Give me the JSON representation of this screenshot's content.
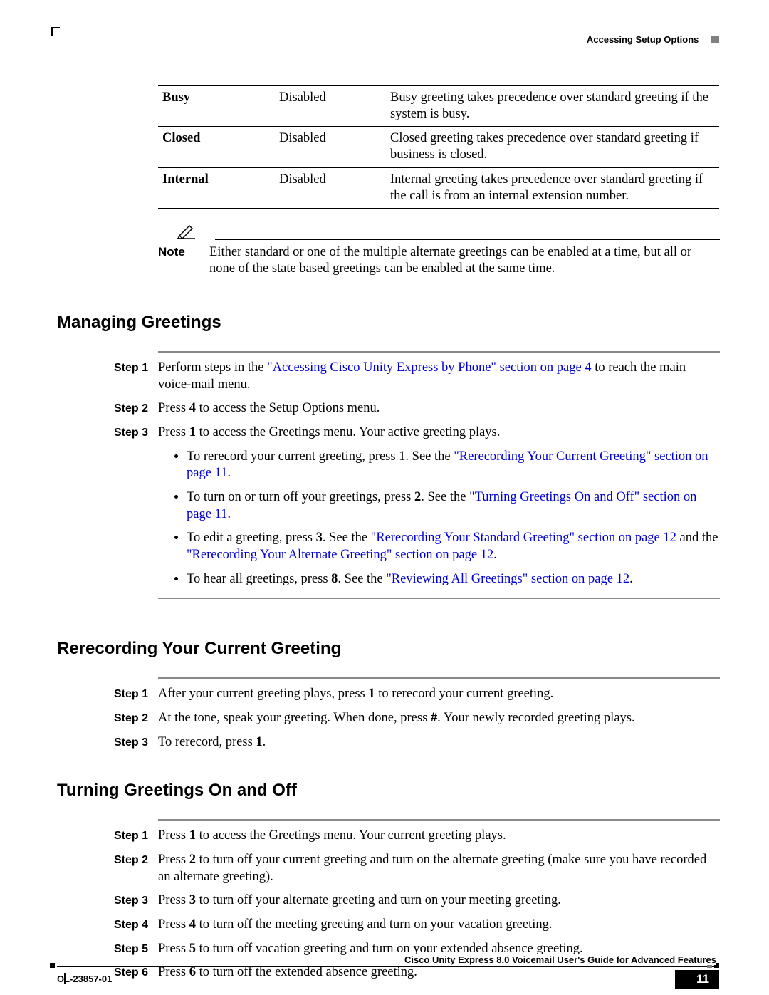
{
  "header": {
    "section": "Accessing Setup Options"
  },
  "table": {
    "rows": [
      {
        "name": "Busy",
        "state": "Disabled",
        "desc": "Busy greeting takes precedence over standard greeting if the system is busy."
      },
      {
        "name": "Closed",
        "state": "Disabled",
        "desc": "Closed greeting takes precedence over standard greeting if business is closed."
      },
      {
        "name": "Internal",
        "state": "Disabled",
        "desc": "Internal greeting takes precedence over standard greeting if the call is from an internal extension number."
      }
    ]
  },
  "note": {
    "label": "Note",
    "text": "Either standard or one of the multiple alternate greetings can be enabled at a time, but all or none of the state based greetings can be enabled at the same time."
  },
  "headings": {
    "managing": "Managing Greetings",
    "rerecord": "Rerecording Your Current Greeting",
    "turning": "Turning Greetings On and Off"
  },
  "managing": {
    "step1_a": "Perform steps in the ",
    "step1_link": "\"Accessing Cisco Unity Express by Phone\" section on page 4",
    "step1_b": " to reach the main voice-mail menu.",
    "step2_a": "Press ",
    "step2_k": "4",
    "step2_b": " to access the Setup Options menu.",
    "step3_a": "Press ",
    "step3_k": "1",
    "step3_b": " to access the Greetings menu. Your active greeting plays.",
    "b1_a": "To rerecord your current greeting, press 1. See the ",
    "b1_link": "\"Rerecording Your Current Greeting\" section on page 11",
    "b1_b": ".",
    "b2_a": "To turn on or turn off your greetings, press ",
    "b2_k": "2",
    "b2_b": ". See the ",
    "b2_link": "\"Turning Greetings On and Off\" section on page 11",
    "b2_c": ".",
    "b3_a": "To edit a greeting, press ",
    "b3_k": "3",
    "b3_b": ". See the ",
    "b3_link1": "\"Rerecording Your Standard Greeting\" section on page 12",
    "b3_c": " and the ",
    "b3_link2": "\"Rerecording Your Alternate Greeting\" section on page 12",
    "b3_d": ".",
    "b4_a": "To hear all greetings, press ",
    "b4_k": "8",
    "b4_b": ". See the ",
    "b4_link": "\"Reviewing All Greetings\" section on page 12",
    "b4_c": "."
  },
  "rerecord": {
    "s1_a": "After your current greeting plays, press ",
    "s1_k": "1",
    "s1_b": " to rerecord your current greeting.",
    "s2_a": "At the tone, speak your greeting. When done, press ",
    "s2_k": "#",
    "s2_b": ". Your newly recorded greeting plays.",
    "s3_a": "To rerecord, press ",
    "s3_k": "1",
    "s3_b": "."
  },
  "turning": {
    "s1_a": "Press ",
    "s1_k": "1",
    "s1_b": " to access the Greetings menu. Your current greeting plays.",
    "s2_a": "Press ",
    "s2_k": "2",
    "s2_b": " to turn off your current greeting and turn on the alternate greeting (make sure you have recorded an alternate greeting).",
    "s3_a": "Press ",
    "s3_k": "3",
    "s3_b": " to turn off your alternate greeting and turn on your meeting greeting.",
    "s4_a": "Press ",
    "s4_k": "4",
    "s4_b": " to turn off the meeting greeting and turn on your vacation greeting.",
    "s5_a": "Press ",
    "s5_k": "5",
    "s5_b": " to turn off vacation greeting and turn on your extended absence greeting.",
    "s6_a": "Press ",
    "s6_k": "6",
    "s6_b": " to turn off the extended absence greeting."
  },
  "step_labels": {
    "s1": "Step 1",
    "s2": "Step 2",
    "s3": "Step 3",
    "s4": "Step 4",
    "s5": "Step 5",
    "s6": "Step 6"
  },
  "footer": {
    "title": "Cisco Unity Express 8.0 Voicemail User's Guide for Advanced Features",
    "doc": "OL-23857-01",
    "page": "11"
  }
}
